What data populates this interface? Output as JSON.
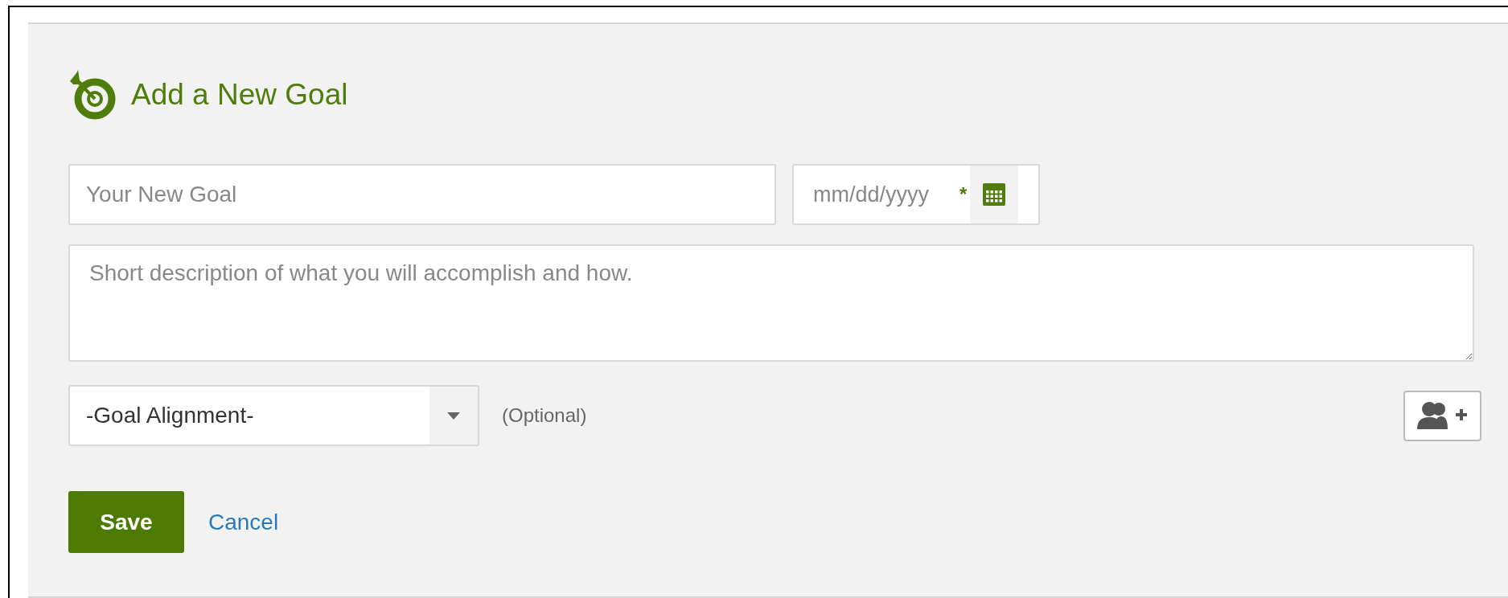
{
  "title": "Add a New Goal",
  "goal_field": {
    "placeholder": "Your New Goal"
  },
  "date_field": {
    "placeholder": "mm/dd/yyyy",
    "required_mark": "*"
  },
  "description_field": {
    "placeholder": "Short description of what you will accomplish and how."
  },
  "alignment_select": {
    "value": "-Goal Alignment-"
  },
  "optional_note": "(Optional)",
  "buttons": [
    {
      "label": "Save",
      "kind": "primary"
    },
    {
      "label": "Cancel",
      "kind": "link"
    }
  ]
}
